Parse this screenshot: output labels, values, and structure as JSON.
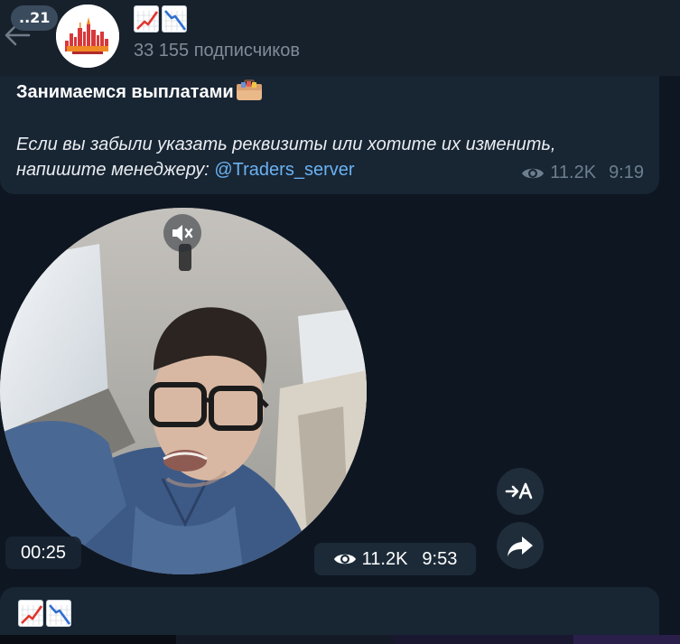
{
  "header": {
    "unread_badge": "..21",
    "subscribers": "33 155 подписчиков",
    "title_emoji": [
      "chart-increasing-icon",
      "chart-decreasing-icon"
    ]
  },
  "message1": {
    "title": "Занимаемся выплатами",
    "body_line1": "Если вы забыли указать реквизиты или хотите их изменить,",
    "body_line2_prefix": "напишите менеджеру: ",
    "link": "@Traders_server",
    "views": "11.2K",
    "time": "9:19"
  },
  "video_message": {
    "duration": "00:25",
    "views": "11.2K",
    "time": "9:53"
  },
  "message3": {
    "emoji": [
      "chart-increasing-icon",
      "chart-decreasing-icon"
    ]
  },
  "colors": {
    "background": "#0e1621",
    "header": "#17212b",
    "bubble": "#182533",
    "link": "#6ab2f2",
    "meta": "#6d7f8f"
  }
}
